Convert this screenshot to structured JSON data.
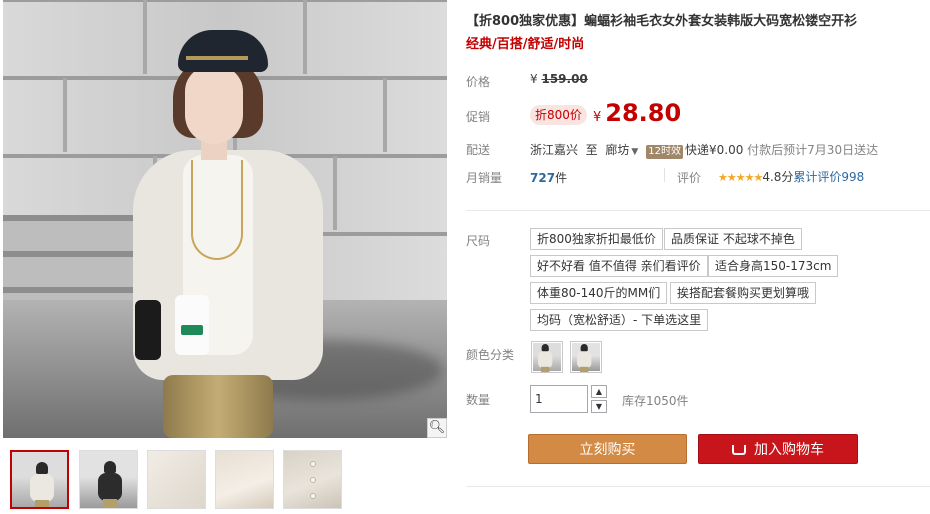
{
  "product": {
    "title": "【折800独家优惠】蝙蝠衫袖毛衣女外套女装韩版大码宽松镂空开衫",
    "subtitle": "经典/百搭/舒适/时尚"
  },
  "gallery": {
    "zoom_icon": "magnifier-icon",
    "thumbnails": [
      "model-front",
      "model-dark-cardigan",
      "fabric-detail",
      "sleeve-detail",
      "button-detail"
    ],
    "active_thumbnail": 0
  },
  "price": {
    "label": "价格",
    "currency": "¥",
    "original": "159.00"
  },
  "promo": {
    "label": "促销",
    "badge": "折800价",
    "currency": "¥",
    "price": "28.80"
  },
  "shipping": {
    "label": "配送",
    "from": "浙江嘉兴",
    "to_word": "至",
    "to": "廊坊",
    "time_tag": "12时效",
    "fee": "快递¥0.00",
    "note": "付款后预计7月30日送达"
  },
  "sales": {
    "label": "月销量",
    "count": "727",
    "unit": "件",
    "rating_label": "评价",
    "stars": "★★★★★",
    "score": "4.8分",
    "review_link": "累计评价998"
  },
  "size": {
    "label": "尺码",
    "options": [
      "折800独家折扣最低价",
      "品质保证 不起球不掉色",
      "好不好看 值不值得 亲们看评价",
      "适合身高150-173cm",
      "体重80-140斤的MM们",
      "挨搭配套餐购买更划算哦",
      "均码（宽松舒适）- 下单选这里"
    ]
  },
  "color": {
    "label": "颜色分类",
    "options": [
      "color-light",
      "color-dark"
    ]
  },
  "quantity": {
    "label": "数量",
    "value": "1",
    "stock": "库存1050件"
  },
  "actions": {
    "buy": "立刻购买",
    "cart": "加入购物车"
  },
  "colors": {
    "accent_red": "#c40000",
    "buy_button": "#d28a45",
    "cart_button": "#c8151b",
    "link_blue": "#2d6a9f"
  }
}
